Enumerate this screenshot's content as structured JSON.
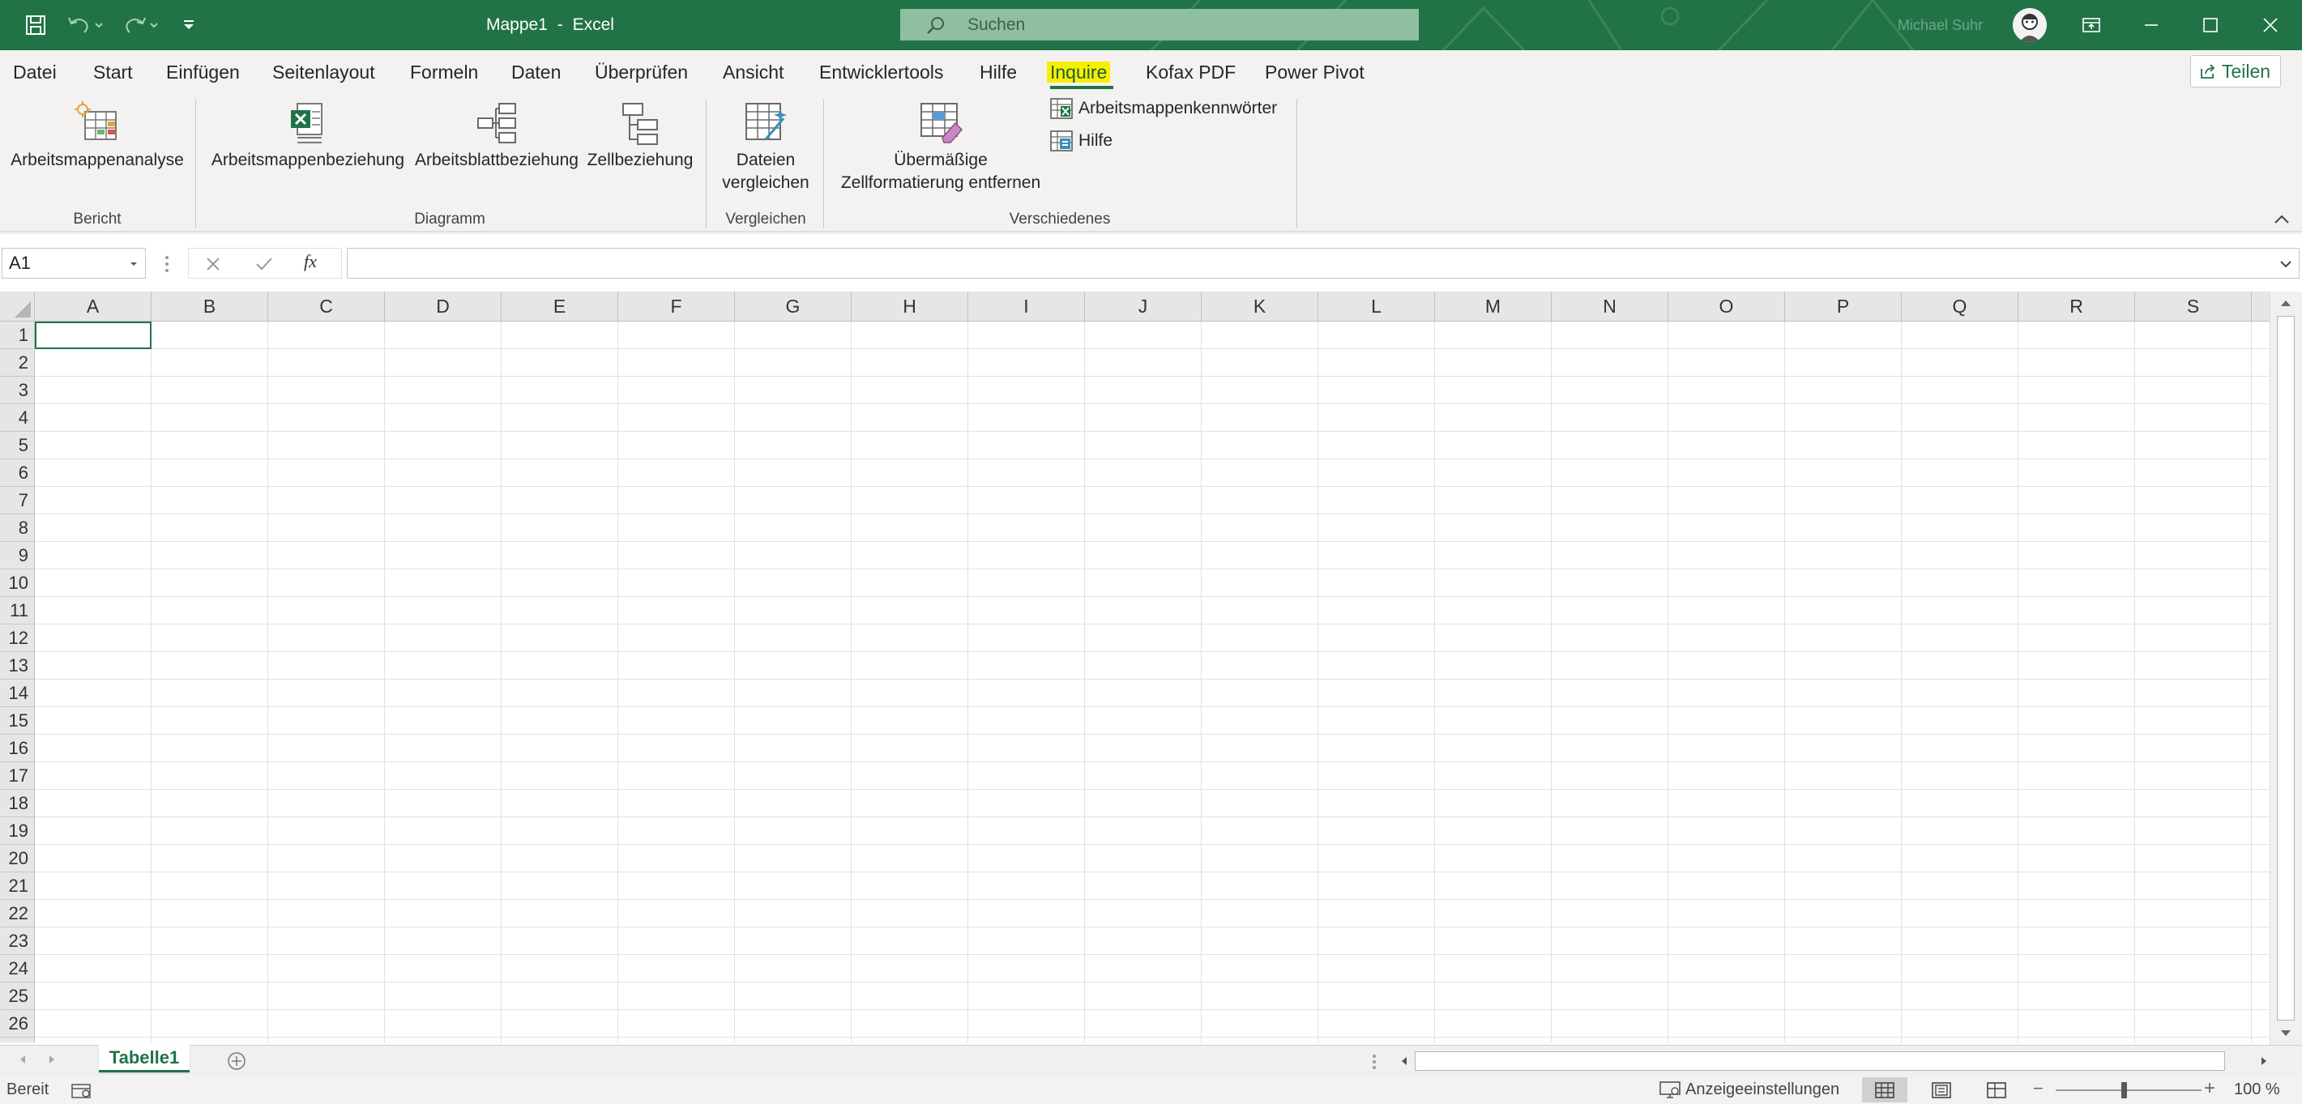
{
  "titlebar": {
    "document_name": "Mappe1",
    "separator": "-",
    "app_name": "Excel",
    "search_placeholder": "Suchen",
    "user_name": "Michael Suhr",
    "accent_color": "#217346",
    "qat_icons": [
      "save-icon",
      "undo-icon",
      "redo-icon",
      "customize-qat-icon"
    ],
    "window_icons": [
      "ribbon-display-options-icon",
      "minimize-icon",
      "maximize-icon",
      "close-icon"
    ]
  },
  "menu": {
    "tabs": [
      {
        "label": "Datei"
      },
      {
        "label": "Start"
      },
      {
        "label": "Einfügen"
      },
      {
        "label": "Seitenlayout"
      },
      {
        "label": "Formeln"
      },
      {
        "label": "Daten"
      },
      {
        "label": "Überprüfen"
      },
      {
        "label": "Ansicht"
      },
      {
        "label": "Entwicklertools"
      },
      {
        "label": "Hilfe"
      },
      {
        "label": "Inquire",
        "active": true,
        "highlight": "#f7f000"
      },
      {
        "label": "Kofax PDF"
      },
      {
        "label": "Power Pivot"
      }
    ],
    "share_label": "Teilen"
  },
  "ribbon": {
    "workbook_analysis": "Arbeitsmappenanalyse",
    "workbook_relationship": "Arbeitsmappenbeziehung",
    "worksheet_relationship": "Arbeitsblattbeziehung",
    "cell_relationship": "Zellbeziehung",
    "compare_files_line1": "Dateien",
    "compare_files_line2": "vergleichen",
    "clean_formatting_line1": "Übermäßige",
    "clean_formatting_line2": "Zellformatierung entfernen",
    "workbook_passwords": "Arbeitsmappenkennwörter",
    "help": "Hilfe",
    "groups": {
      "report": "Bericht",
      "diagram": "Diagramm",
      "compare": "Vergleichen",
      "misc": "Verschiedenes"
    }
  },
  "formula_bar": {
    "name_box": "A1",
    "function_label": "fx",
    "formula": ""
  },
  "grid": {
    "columns": [
      "A",
      "B",
      "C",
      "D",
      "E",
      "F",
      "G",
      "H",
      "I",
      "J",
      "K",
      "L",
      "M",
      "N",
      "O",
      "P",
      "Q",
      "R",
      "S"
    ],
    "rows": [
      "1",
      "2",
      "3",
      "4",
      "5",
      "6",
      "7",
      "8",
      "9",
      "10",
      "11",
      "12",
      "13",
      "14",
      "15",
      "16",
      "17",
      "18",
      "19",
      "20",
      "21",
      "22",
      "23",
      "24",
      "25",
      "26"
    ]
  },
  "sheets": {
    "tabs": [
      "Tabelle1"
    ],
    "active": "Tabelle1"
  },
  "status": {
    "ready": "Bereit",
    "display_settings": "Anzeigeeinstellungen",
    "zoom_level": "100 %",
    "zoom_percent": 100,
    "views": [
      "normal-view-icon",
      "page-layout-view-icon",
      "page-break-preview-icon"
    ],
    "active_view": "normal-view-icon"
  }
}
